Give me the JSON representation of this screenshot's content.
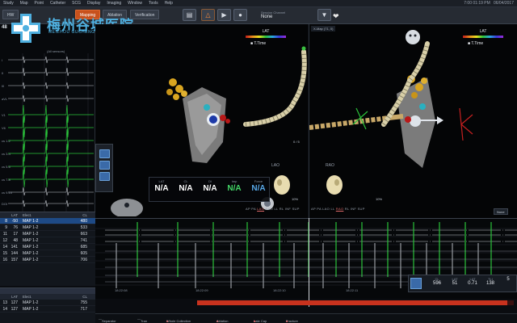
{
  "menu": [
    "Study",
    "Map",
    "Point",
    "Catheter",
    "SCG",
    "Display",
    "Imaging",
    "Window",
    "Tools",
    "Help"
  ],
  "clock": "7:00 01:19 PM",
  "date": "06/04/2017",
  "toolbar": {
    "hw_label": "HW",
    "tabs": [
      {
        "label": "Mapping",
        "active": true
      },
      {
        "label": "Ablation",
        "active": false
      },
      {
        "label": "Verification",
        "active": false
      }
    ],
    "session_label": "Session Channel",
    "session_value": "None",
    "hr": "48"
  },
  "hospital": {
    "name_cn": "梅州谷城医院",
    "name_en": "MEIZHOU GUCHENG HOSPITAL"
  },
  "map_left": {
    "legend_title": "LAT",
    "legend_sub": "T.Time",
    "view": "LAO",
    "fraction": "0 / 5",
    "pct": "10%",
    "view_tabs": [
      "AP",
      "PA",
      "LAO",
      "RAO",
      "LL",
      "RL",
      "INF",
      "SUP"
    ],
    "selected_view": "LAO"
  },
  "map_right": {
    "header": "X-Map (71, 0)",
    "legend_title": "LAT",
    "legend_sub": "T.Time",
    "view": "RAO",
    "fraction": "0 / 5",
    "pct": "10%",
    "view_tabs": [
      "AP",
      "PA",
      "LAO",
      "LL",
      "RAO",
      "RL",
      "INF",
      "SUP"
    ],
    "selected_view": "RAO",
    "dropdown": "None"
  },
  "annotation": {
    "columns": [
      {
        "header": "LAT",
        "value": "N/A",
        "color": "#ffffff"
      },
      {
        "header": "CL",
        "value": "N/A",
        "color": "#ffffff"
      },
      {
        "header": "Di",
        "value": "N/A",
        "color": "#ffffff"
      },
      {
        "header": "Imp",
        "value": "N/A",
        "color": "#44d868"
      },
      {
        "header": "Force",
        "value": "N/A",
        "color": "#58a8e8"
      }
    ]
  },
  "left_ecg": {
    "lead_labels": [
      "I",
      "II",
      "III",
      "aVL",
      "V1",
      "V6",
      "cs 1-2",
      "cs 3-4",
      "cs 5-6",
      "cs 7-8",
      "cs 9-10",
      "DOI",
      "Map"
    ],
    "header": "(All sensors)"
  },
  "table_a": {
    "headers": [
      "",
      "LAT",
      "Elect.",
      "CL"
    ],
    "rows": [
      {
        "idx": "8",
        "lat": "-50",
        "elect": "MAP 1-2",
        "cl": "480",
        "selected": true
      },
      {
        "idx": "9",
        "lat": "76",
        "elect": "MAP 1-2",
        "cl": "533",
        "selected": false
      },
      {
        "idx": "11",
        "lat": "17",
        "elect": "MAP 1-2",
        "cl": "663",
        "selected": false
      },
      {
        "idx": "12",
        "lat": "48",
        "elect": "MAP 1-2",
        "cl": "741",
        "selected": false
      },
      {
        "idx": "14",
        "lat": "141",
        "elect": "MAP 1-2",
        "cl": "685",
        "selected": false
      },
      {
        "idx": "15",
        "lat": "144",
        "elect": "MAP 1-2",
        "cl": "605",
        "selected": false
      },
      {
        "idx": "16",
        "lat": "157",
        "elect": "MAP 1-2",
        "cl": "706",
        "selected": false
      }
    ]
  },
  "table_b": {
    "headers": [
      "",
      "LAT",
      "Elect.",
      "CL"
    ],
    "rows": [
      {
        "idx": "13",
        "lat": "127",
        "elect": "MAP 1-2",
        "cl": "755",
        "selected": false
      },
      {
        "idx": "14",
        "lat": "127",
        "elect": "MAP 1-2",
        "cl": "717",
        "selected": false
      }
    ]
  },
  "readout": {
    "columns": [
      {
        "header": "CL",
        "value": "596"
      },
      {
        "header": "LAT",
        "value": "51"
      },
      {
        "header": "LAT",
        "value": "0.71"
      },
      {
        "header": "TLI",
        "value": "138"
      },
      {
        "header": "",
        "value": "5"
      }
    ]
  },
  "signal_strip": {
    "time_labels": [
      "18:22:08",
      "18:22:09",
      "18:22:10",
      "18:22:11",
      "18:22:12"
    ],
    "channel_labels": [
      "I",
      "II",
      "aVF",
      "V1",
      "cs 1-2",
      "cs 3-4",
      "cs 5-6",
      "cs 7-8",
      "cs 9-10",
      "Map 1-2",
      "Map 3-4"
    ],
    "progress_pct": 98
  },
  "bottom_legend": [
    "Separator",
    "Tran",
    "Whole Collection",
    "Ablation",
    "Late Cap",
    "Fracture"
  ],
  "colors": {
    "accent": "#c8511c",
    "selected_row": "#1e4a86",
    "green_signal": "#2ac33a",
    "progress": "#c8321e"
  }
}
